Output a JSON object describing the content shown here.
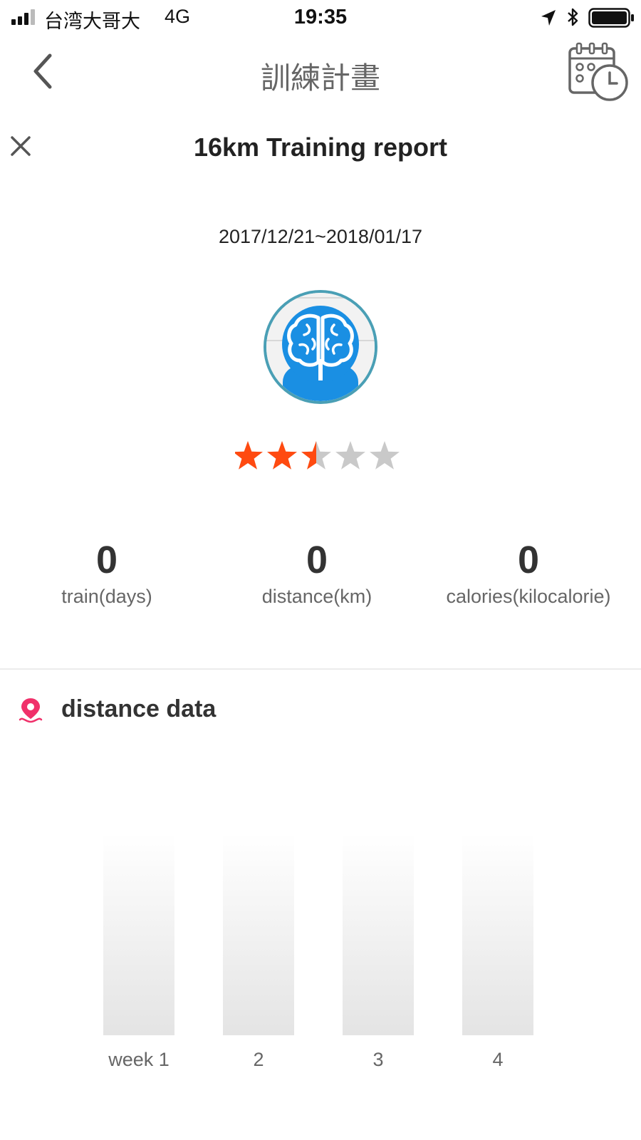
{
  "status_bar": {
    "carrier": "台湾大哥大",
    "network": "4G",
    "time": "19:35"
  },
  "nav": {
    "title": "訓練計畫",
    "back_icon": "chevron-left-icon",
    "calendar_icon": "calendar-clock-icon"
  },
  "report": {
    "title": "16km Training report",
    "date_range": "2017/12/21~2018/01/17",
    "avatar_icon": "brain-icon",
    "rating": 2.5,
    "rating_max": 5
  },
  "stats": [
    {
      "value": "0",
      "label": "train(days)"
    },
    {
      "value": "0",
      "label": "distance(km)"
    },
    {
      "value": "0",
      "label": "calories(kilocalorie)"
    }
  ],
  "distance_section": {
    "title": "distance data",
    "icon": "location-pin-icon"
  },
  "colors": {
    "star_active": "#ff4a10",
    "star_inactive": "#c9c9c9",
    "avatar_blue": "#1a8fe3",
    "avatar_ring": "#4a9fb5",
    "pin_red": "#f0306a",
    "bar_gray": "#e6e6e6"
  },
  "chart_data": {
    "type": "bar",
    "categories": [
      "week 1",
      "2",
      "3",
      "4"
    ],
    "values": [
      0,
      0,
      0,
      0
    ]
  }
}
